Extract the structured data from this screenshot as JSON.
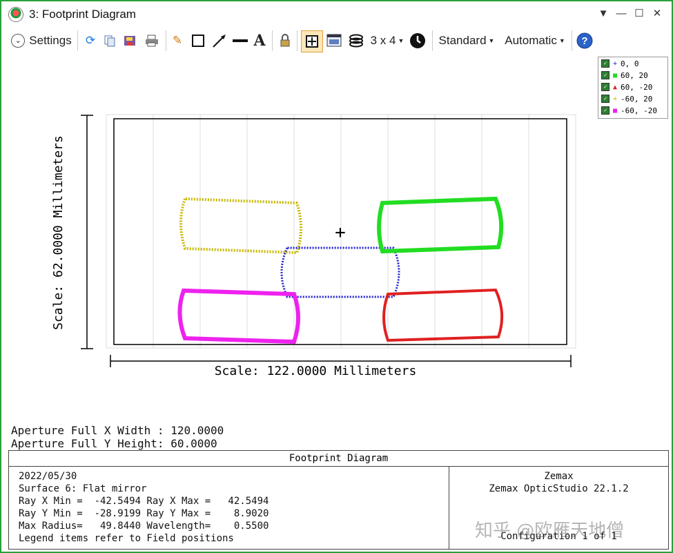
{
  "window": {
    "title": "3: Footprint Diagram",
    "controls": [
      "▼",
      "—",
      "☐",
      "✕"
    ]
  },
  "toolbar": {
    "settings_label": "Settings",
    "layout_label": "3 x 4",
    "standard_label": "Standard",
    "automatic_label": "Automatic",
    "icons": [
      "refresh-icon",
      "copy-icon",
      "save-icon",
      "print-icon",
      "pencil-icon",
      "rectangle-icon",
      "arrow-icon",
      "line-icon",
      "text-icon",
      "lock-icon",
      "grid-icon",
      "window-icon",
      "layers-icon",
      "dropdown-icon",
      "clock-icon",
      "help-icon"
    ]
  },
  "legend": {
    "items": [
      {
        "label": "0, 0",
        "color": "#1f1fd0",
        "symbol": "+"
      },
      {
        "label": "60, 20",
        "color": "#22dd22",
        "symbol": "■"
      },
      {
        "label": "60, -20",
        "color": "#e02020",
        "symbol": "▲"
      },
      {
        "label": "-60, 20",
        "color": "#c8b800",
        "symbol": "+"
      },
      {
        "label": "-60, -20",
        "color": "#ee22ee",
        "symbol": "■"
      }
    ]
  },
  "plot": {
    "y_scale_label": "Scale: 62.0000 Millimeters",
    "x_scale_label": "Scale: 122.0000 Millimeters",
    "center_marker": "+"
  },
  "aperture": {
    "x_width": "Aperture Full X Width : 120.0000",
    "y_height": "Aperture Full Y Height: 60.0000"
  },
  "info": {
    "title": "Footprint Diagram",
    "date": "2022/05/30",
    "surface": "Surface 6: Flat mirror",
    "ray_x": "Ray X Min =  -42.5494 Ray X Max =   42.5494",
    "ray_y": "Ray Y Min =  -28.9199 Ray Y Max =    8.9020",
    "max_radius": "Max Radius=   49.8440 Wavelength=    0.5500",
    "legend_note": "Legend items refer to Field positions",
    "company": "Zemax",
    "product": "Zemax OpticStudio 22.1.2",
    "configuration": "Configuration 1 of 1"
  },
  "watermark": "知乎 @欧雁天地僧"
}
